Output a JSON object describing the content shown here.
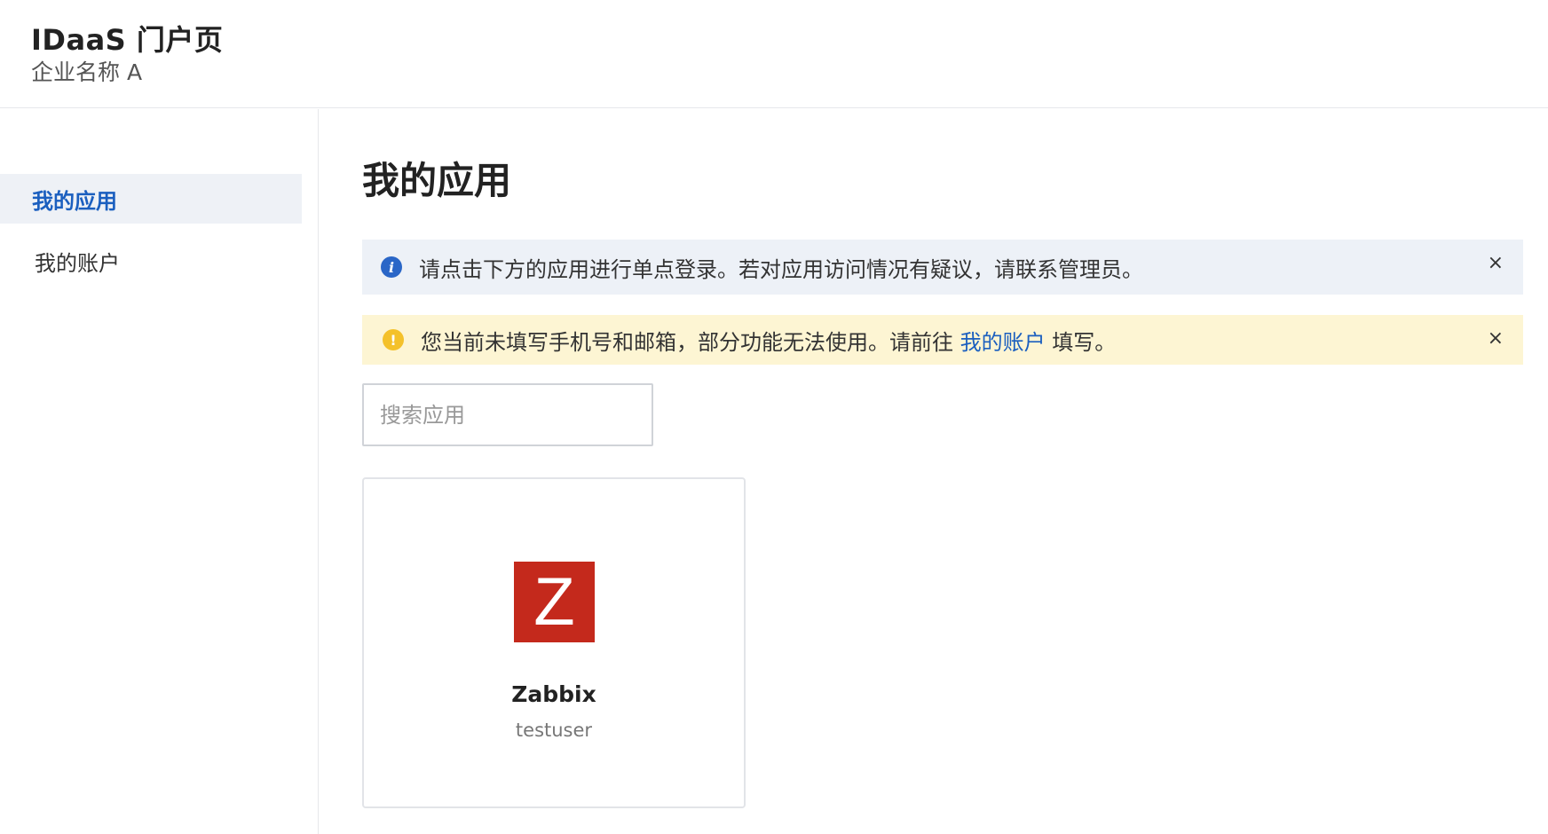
{
  "header": {
    "title": "IDaaS 门户页",
    "subtitle": "企业名称 A"
  },
  "sidebar": {
    "items": [
      {
        "label": "我的应用",
        "active": true
      },
      {
        "label": "我的账户",
        "active": false
      }
    ]
  },
  "main": {
    "title": "我的应用",
    "info_alert": {
      "icon": "info-icon",
      "text": "请点击下方的应用进行单点登录。若对应用访问情况有疑议，请联系管理员。",
      "close": "×"
    },
    "warn_alert": {
      "icon": "warning-icon",
      "text_before": "您当前未填写手机号和邮箱，部分功能无法使用。请前往 ",
      "link": "我的账户",
      "text_after": " 填写。",
      "close": "×"
    },
    "search": {
      "placeholder": "搜索应用",
      "value": ""
    },
    "apps": [
      {
        "logo_letter": "Z",
        "name": "Zabbix",
        "user": "testuser",
        "logo_color": "#c4291c"
      }
    ]
  },
  "colors": {
    "accent": "#1b5fbf",
    "info_bg": "#edf1f7",
    "warn_bg": "#fdf5d3",
    "warn_icon": "#f4c12a",
    "info_icon": "#2a66c7"
  }
}
